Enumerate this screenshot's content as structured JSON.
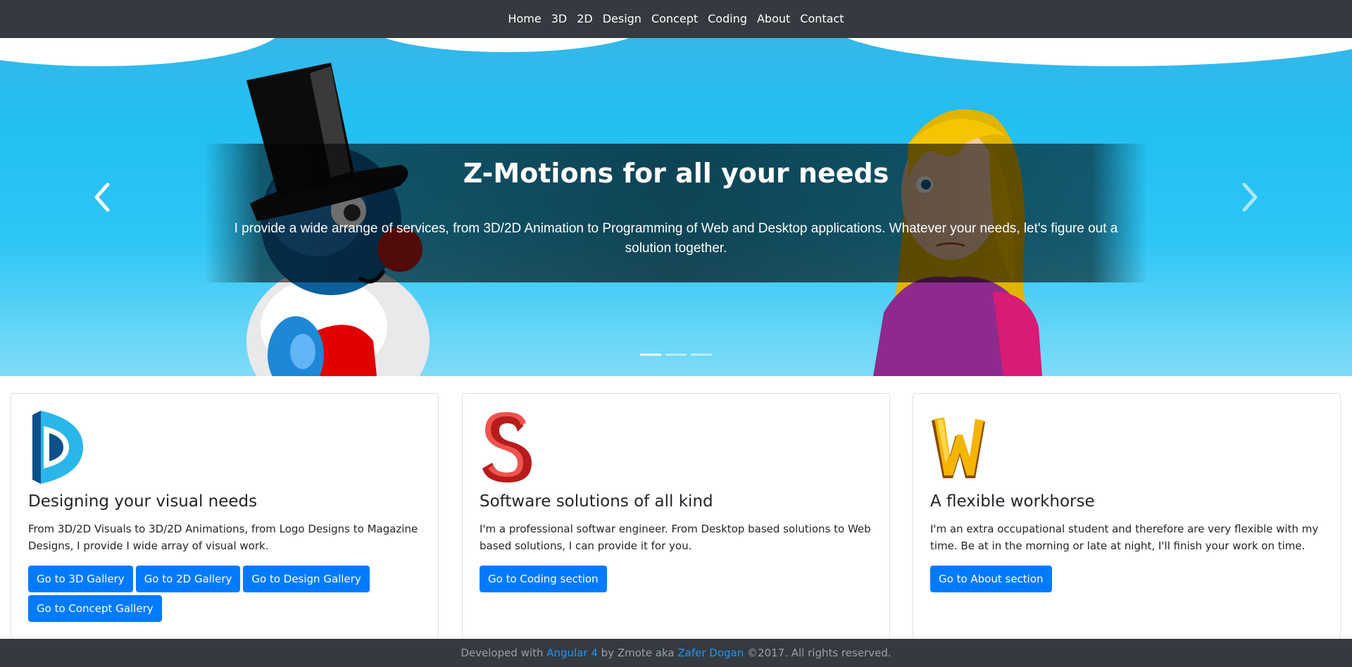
{
  "nav": {
    "items": [
      {
        "label": "Home"
      },
      {
        "label": "3D"
      },
      {
        "label": "2D"
      },
      {
        "label": "Design"
      },
      {
        "label": "Concept"
      },
      {
        "label": "Coding"
      },
      {
        "label": "About"
      },
      {
        "label": "Contact"
      }
    ]
  },
  "hero": {
    "title": "Z-Motions for all your needs",
    "text": "I provide a wide arrange of services, from 3D/2D Animation to Programming of Web and Desktop applications. Whatever your needs, let's figure out a solution together.",
    "active_slide": 1,
    "slide_count": 3,
    "prev_icon": "chevron-left-icon",
    "next_icon": "chevron-right-icon"
  },
  "cards": [
    {
      "logo": "letter-d-logo",
      "title": "Designing your visual needs",
      "text": "From 3D/2D Visuals to 3D/2D Animations, from Logo Designs to Magazine Designs, I provide I wide array of visual work.",
      "buttons": [
        "Go to 3D Gallery",
        "Go to 2D Gallery",
        "Go to Design Gallery",
        "Go to Concept Gallery"
      ]
    },
    {
      "logo": "letter-s-logo",
      "title": "Software solutions of all kind",
      "text": "I'm a professional softwar engineer. From Desktop based solutions to Web based solutions, I can provide it for you.",
      "buttons": [
        "Go to Coding section"
      ]
    },
    {
      "logo": "letter-w-logo",
      "title": "A flexible workhorse",
      "text": "I'm an extra occupational student and therefore are very flexible with my time. Be at in the morning or late at night, I'll finish your work on time.",
      "buttons": [
        "Go to About section"
      ]
    }
  ],
  "footer": {
    "prefix": "Developed with",
    "framework_link": "Angular 4",
    "middle": "by Zmote aka",
    "author_link": "Zafer Dogan",
    "suffix": "©2017. All rights reserved."
  },
  "colors": {
    "navbar_bg": "#343a40",
    "primary_button": "#007bff",
    "sky": "#22bff2"
  }
}
